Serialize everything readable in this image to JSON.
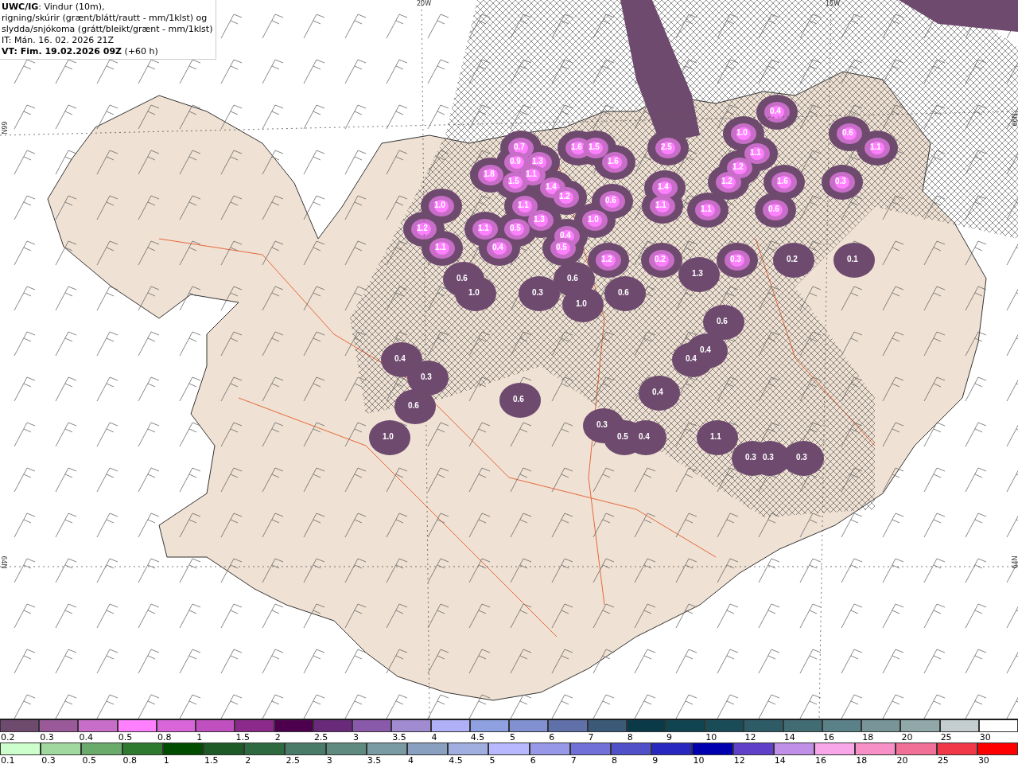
{
  "header": {
    "lines": [
      "**UWC/IG**: Vindur (10m),",
      "rigning/skúrir (grænt/blátt/rautt - mm/1klst) og",
      "slydda/snjókoma (grátt/bleikt/grænt - mm/1klst)",
      "IT: Mán. 16. 02. 2026 21Z",
      "**VT: Fim. 19.02.2026 09Z** (+60 h)"
    ]
  },
  "map": {
    "grid_labels": [
      "20W",
      "15W",
      "66N",
      "64N",
      "66N",
      "64N"
    ],
    "values": [
      "0.4",
      "1.0",
      "0.6",
      "0.7",
      "1.6",
      "1.5",
      "2.5",
      "1.1",
      "1.1",
      "0.9",
      "1.3",
      "1.6",
      "1.2",
      "1.8",
      "1.1",
      "1.5",
      "1.2",
      "1.6",
      "0.3",
      "1.4",
      "1.4",
      "1.2",
      "0.6",
      "1.0",
      "1.1",
      "1.1",
      "1.1",
      "0.6",
      "1.3",
      "1.0",
      "1.2",
      "1.1",
      "0.5",
      "0.4",
      "1.1",
      "0.4",
      "0.5",
      "1.2",
      "0.2",
      "0.3",
      "0.2",
      "0.1",
      "1.3",
      "0.6",
      "0.6",
      "1.0",
      "0.3",
      "0.6",
      "1.0",
      "0.6",
      "0.4",
      "0.4",
      "0.4",
      "0.3",
      "0.4",
      "0.6",
      "0.6",
      "0.3",
      "1.0",
      "0.5",
      "0.4",
      "1.1",
      "0.3",
      "0.3",
      "0.3"
    ]
  },
  "legend_snow": [
    {
      "label": "0.2",
      "color": "#6e4a6e"
    },
    {
      "label": "0.3",
      "color": "#9a5a9a"
    },
    {
      "label": "0.4",
      "color": "#c86ec8"
    },
    {
      "label": "0.5",
      "color": "#ff80ff"
    },
    {
      "label": "0.8",
      "color": "#d966d9"
    },
    {
      "label": "1",
      "color": "#c050c0"
    },
    {
      "label": "1.5",
      "color": "#8c2a8c"
    },
    {
      "label": "2",
      "color": "#4d004d"
    },
    {
      "label": "2.5",
      "color": "#6a2a7a"
    },
    {
      "label": "3",
      "color": "#8a5aaa"
    },
    {
      "label": "3.5",
      "color": "#a08ad0"
    },
    {
      "label": "4",
      "color": "#b0b0f8"
    },
    {
      "label": "4.5",
      "color": "#8fa0e0"
    },
    {
      "label": "5",
      "color": "#8090d0"
    },
    {
      "label": "6",
      "color": "#6070a8"
    },
    {
      "label": "7",
      "color": "#3a5a78"
    },
    {
      "label": "8",
      "color": "#0a3a48"
    },
    {
      "label": "9",
      "color": "#104450"
    },
    {
      "label": "10",
      "color": "#1a4c58"
    },
    {
      "label": "12",
      "color": "#2e5c66"
    },
    {
      "label": "14",
      "color": "#426c74"
    },
    {
      "label": "16",
      "color": "#5a8088"
    },
    {
      "label": "18",
      "color": "#789498"
    },
    {
      "label": "20",
      "color": "#90a8aa"
    },
    {
      "label": "25",
      "color": "#c4ced0"
    },
    {
      "label": "30",
      "color": "#ffffff"
    }
  ],
  "legend_rain": [
    {
      "label": "0.1",
      "color": "#ccffcc"
    },
    {
      "label": "0.3",
      "color": "#a0d8a0"
    },
    {
      "label": "0.5",
      "color": "#6aaa6a"
    },
    {
      "label": "0.8",
      "color": "#2e7a2e"
    },
    {
      "label": "1",
      "color": "#004d00"
    },
    {
      "label": "1.5",
      "color": "#1e5a28"
    },
    {
      "label": "2",
      "color": "#2e6a40"
    },
    {
      "label": "2.5",
      "color": "#4a7a68"
    },
    {
      "label": "3",
      "color": "#5e8a80"
    },
    {
      "label": "3.5",
      "color": "#7a9aa4"
    },
    {
      "label": "4",
      "color": "#8aa0c0"
    },
    {
      "label": "4.5",
      "color": "#a0aee0"
    },
    {
      "label": "5",
      "color": "#b8b8ff"
    },
    {
      "label": "6",
      "color": "#9898e8"
    },
    {
      "label": "7",
      "color": "#7070d8"
    },
    {
      "label": "8",
      "color": "#5050c8"
    },
    {
      "label": "9",
      "color": "#2828c0"
    },
    {
      "label": "10",
      "color": "#0000b0"
    },
    {
      "label": "12",
      "color": "#6040c8"
    },
    {
      "label": "14",
      "color": "#c090e8"
    },
    {
      "label": "16",
      "color": "#f8a8e8"
    },
    {
      "label": "18",
      "color": "#f890c8"
    },
    {
      "label": "20",
      "color": "#f07098"
    },
    {
      "label": "25",
      "color": "#f03848"
    },
    {
      "label": "30",
      "color": "#ff0000"
    }
  ]
}
